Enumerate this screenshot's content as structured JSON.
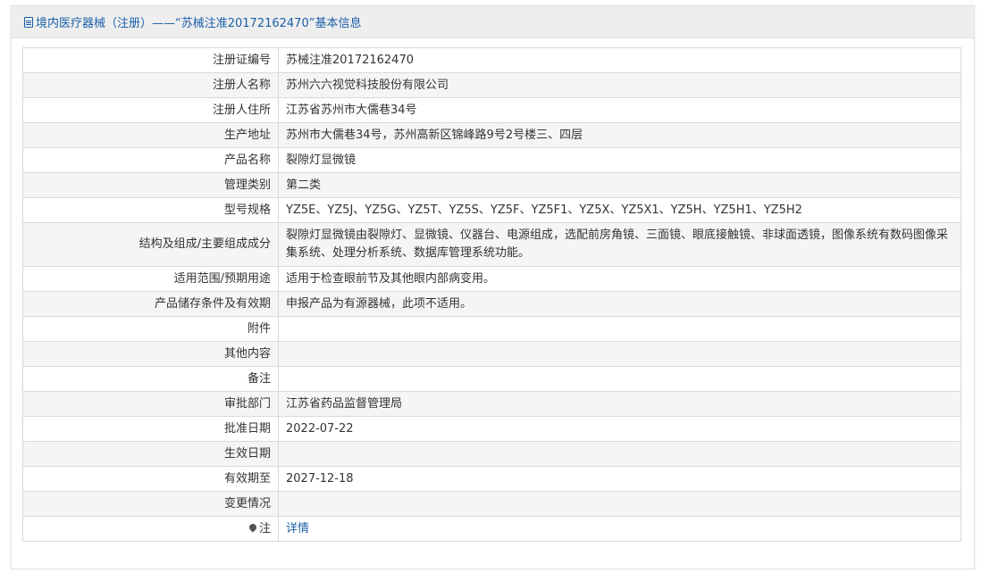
{
  "header": {
    "icon": "document-icon",
    "title": "境内医疗器械（注册）——“苏械注准20172162470”基本信息"
  },
  "rows": [
    {
      "label": "注册证编号",
      "value": "苏械注准20172162470"
    },
    {
      "label": "注册人名称",
      "value": "苏州六六视觉科技股份有限公司"
    },
    {
      "label": "注册人住所",
      "value": "江苏省苏州市大儒巷34号"
    },
    {
      "label": "生产地址",
      "value": "苏州市大儒巷34号，苏州高新区锦峰路9号2号楼三、四层"
    },
    {
      "label": "产品名称",
      "value": "裂隙灯显微镜"
    },
    {
      "label": "管理类别",
      "value": "第二类"
    },
    {
      "label": "型号规格",
      "value": "YZ5E、YZ5J、YZ5G、YZ5T、YZ5S、YZ5F、YZ5F1、YZ5X、YZ5X1、YZ5H、YZ5H1、YZ5H2"
    },
    {
      "label": "结构及组成/主要组成成分",
      "value": "裂隙灯显微镜由裂隙灯、显微镜、仪器台、电源组成，选配前房角镜、三面镜、眼底接触镜、非球面透镜，图像系统有数码图像采集系统、处理分析系统、数据库管理系统功能。"
    },
    {
      "label": "适用范围/预期用途",
      "value": "适用于检查眼前节及其他眼内部病变用。"
    },
    {
      "label": "产品储存条件及有效期",
      "value": "申报产品为有源器械，此项不适用。"
    },
    {
      "label": "附件",
      "value": ""
    },
    {
      "label": "其他内容",
      "value": ""
    },
    {
      "label": "备注",
      "value": ""
    },
    {
      "label": "审批部门",
      "value": "江苏省药品监督管理局"
    },
    {
      "label": "批准日期",
      "value": "2022-07-22"
    },
    {
      "label": "生效日期",
      "value": ""
    },
    {
      "label": "有效期至",
      "value": "2027-12-18"
    },
    {
      "label": "变更情况",
      "value": ""
    }
  ],
  "note_row": {
    "icon": "pin-icon",
    "label": "注",
    "link_text": "详情"
  },
  "colors": {
    "accent": "#1a5fa8",
    "header_bg": "#eeeeee",
    "row_alt_bg": "#f5f5f5",
    "border": "#d9d9d9"
  }
}
